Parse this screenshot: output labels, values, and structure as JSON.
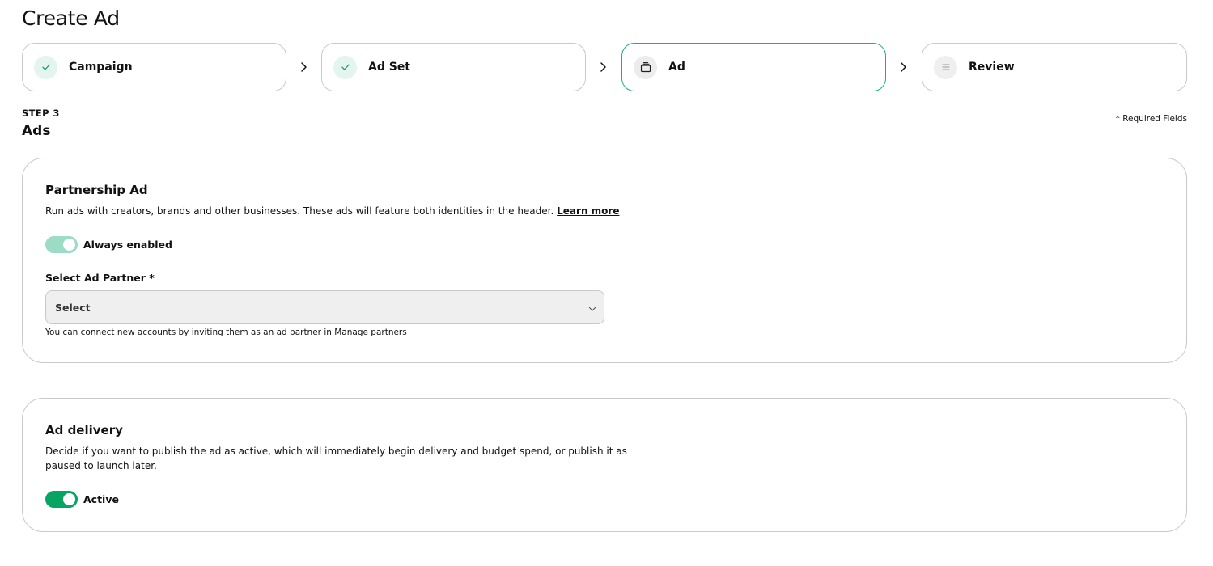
{
  "page": {
    "title": "Create Ad"
  },
  "stepper": {
    "steps": [
      {
        "label": "Campaign",
        "state": "done",
        "icon": "check-icon"
      },
      {
        "label": "Ad Set",
        "state": "done",
        "icon": "check-icon"
      },
      {
        "label": "Ad",
        "state": "current",
        "icon": "ad-stack-icon"
      },
      {
        "label": "Review",
        "state": "pending",
        "icon": "list-icon"
      }
    ],
    "separator_icon": "chevron-right-icon"
  },
  "step_header": {
    "kicker": "STEP 3",
    "heading": "Ads",
    "required_note": "* Required Fields"
  },
  "partnership": {
    "title": "Partnership Ad",
    "description": "Run ads with creators, brands and other businesses. These ads will feature both identities in the header.",
    "learn_more": "Learn more",
    "toggle_label": "Always enabled",
    "field_label": "Select Ad Partner *",
    "select_value": "Select",
    "helper": "You can connect new accounts by inviting them as an ad partner in Manage partners"
  },
  "delivery": {
    "title": "Ad delivery",
    "description_line1": "Decide if you want to publish the ad as active, which will immediately begin delivery and budget spend, or publish it as",
    "description_line2": "paused to launch later.",
    "toggle_label": "Active"
  },
  "colors": {
    "accent": "#07a463",
    "accent_muted": "#9ddcc4",
    "active_border": "#25a88a",
    "border": "#c9c9c9"
  }
}
